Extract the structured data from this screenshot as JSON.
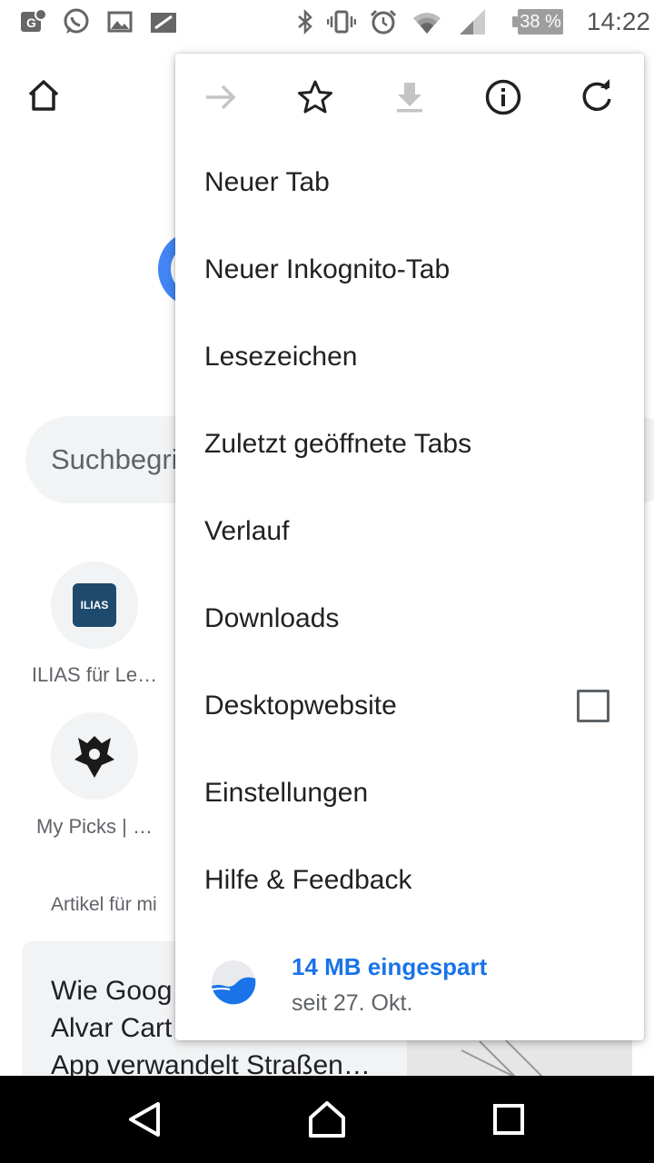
{
  "status_bar": {
    "time": "14:22",
    "battery_percent": "38 %",
    "icons": [
      "maps-notification-icon",
      "whatsapp-icon",
      "gallery-icon",
      "screenshot-icon",
      "bluetooth-icon",
      "vibrate-icon",
      "alarm-icon",
      "wifi-icon",
      "signal-icon",
      "battery-icon"
    ]
  },
  "background_page": {
    "search_placeholder": "Suchbegri",
    "tiles": [
      {
        "label": "ILIAS für Le…",
        "logo_text": "ILIAS",
        "icon": "ilias-logo"
      },
      {
        "label": "My Picks | …",
        "icon": "worlds-logo"
      }
    ],
    "articles_heading": "Artikel für mi",
    "article_title": "Wie Goog\nAlvar Cart\nApp verwandelt Straßen…"
  },
  "menu": {
    "toolbar": [
      "forward-icon",
      "bookmark-star-icon",
      "download-icon",
      "info-icon",
      "reload-icon"
    ],
    "items": [
      {
        "label": "Neuer Tab"
      },
      {
        "label": "Neuer Inkognito-Tab"
      },
      {
        "label": "Lesezeichen"
      },
      {
        "label": "Zuletzt geöffnete Tabs"
      },
      {
        "label": "Verlauf"
      },
      {
        "label": "Downloads"
      },
      {
        "label": "Desktopwebsite",
        "checked": false
      },
      {
        "label": "Einstellungen"
      },
      {
        "label": "Hilfe & Feedback"
      }
    ],
    "savings": {
      "title": "14 MB eingespart",
      "subtitle": "seit 27. Okt."
    }
  },
  "nav_bar": [
    "back-icon",
    "home-icon",
    "recents-icon"
  ],
  "colors": {
    "accent": "#1a73e8",
    "google_blue": "#4285f4",
    "text_primary": "#202124",
    "text_secondary": "#5f6368",
    "surface_gray": "#f1f3f4"
  }
}
